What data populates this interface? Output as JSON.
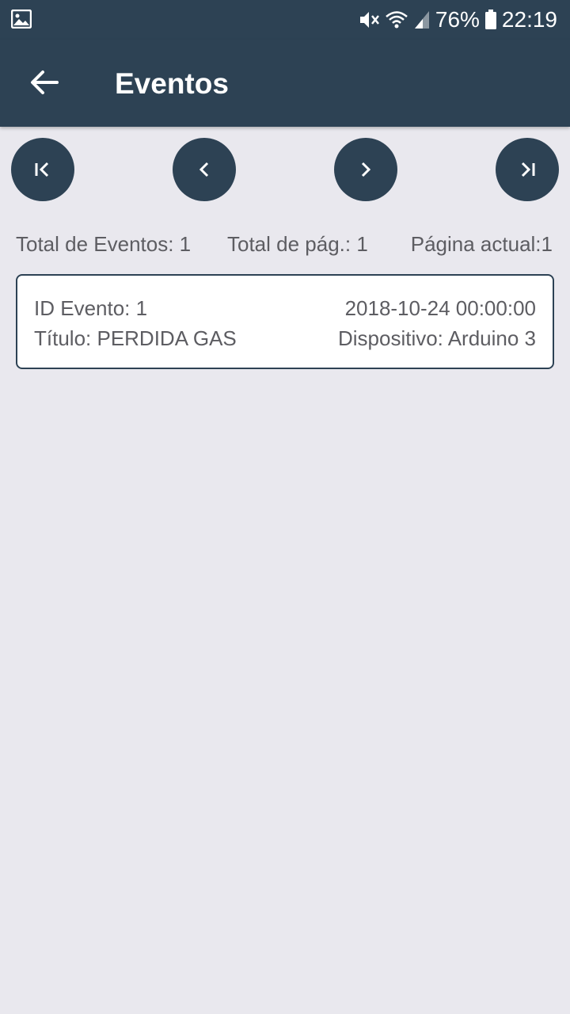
{
  "status_bar": {
    "battery_percent": "76%",
    "time": "22:19",
    "icons": [
      "image-icon",
      "mute-icon",
      "wifi-icon",
      "signal-icon",
      "battery-icon"
    ]
  },
  "app_bar": {
    "title": "Eventos",
    "back_icon": "arrow-left-icon"
  },
  "pagination": {
    "buttons": [
      {
        "name": "first-page-button",
        "icon": "first-page-icon"
      },
      {
        "name": "previous-page-button",
        "icon": "chevron-left-icon"
      },
      {
        "name": "next-page-button",
        "icon": "chevron-right-icon"
      },
      {
        "name": "last-page-button",
        "icon": "last-page-icon"
      }
    ],
    "total_events": "Total de Eventos: 1",
    "total_pages": "Total de pág.: 1",
    "current_page": "Página actual:1"
  },
  "events": [
    {
      "id": "ID Evento: 1",
      "datetime": "2018-10-24 00:00:00",
      "title": "Título: PERDIDA GAS",
      "device": "Dispositivo: Arduino 3"
    }
  ],
  "colors": {
    "primary": "#2d4254",
    "background": "#e9e8ee",
    "card": "#ffffff",
    "text": "#5d5d62"
  }
}
